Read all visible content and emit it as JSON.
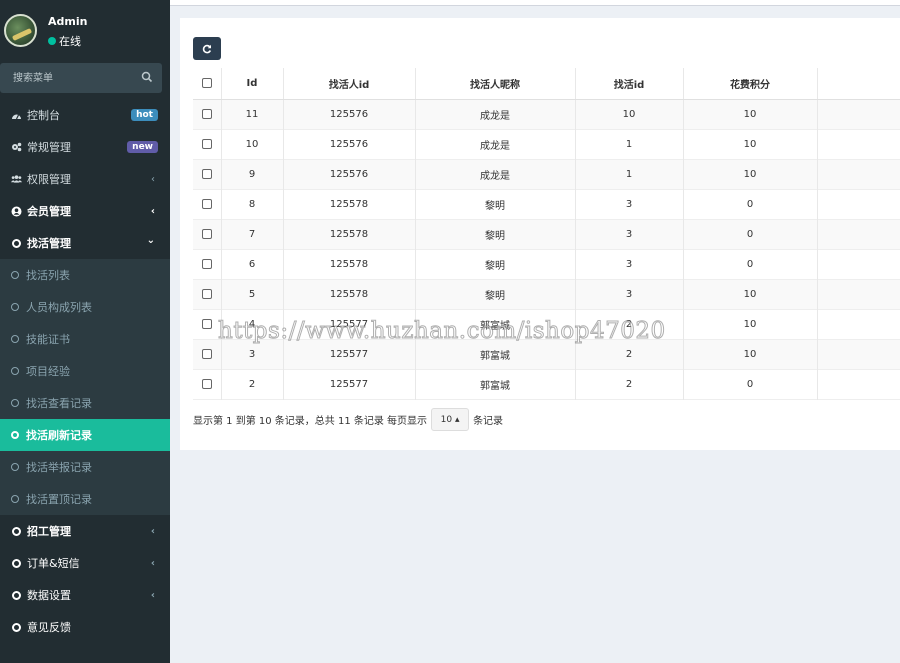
{
  "user": {
    "name": "Admin",
    "status": "在线"
  },
  "search": {
    "placeholder": "搜索菜单"
  },
  "menu": [
    {
      "label": "控制台",
      "badge": "hot"
    },
    {
      "label": "常规管理",
      "badge": "new"
    },
    {
      "label": "权限管理",
      "chevron": "‹"
    },
    {
      "label": "会员管理",
      "chevron": "‹"
    },
    {
      "label": "找活管理",
      "chevron": "⌄"
    },
    {
      "label": "招工管理",
      "chevron": "‹"
    },
    {
      "label": "订单&短信",
      "chevron": "‹"
    },
    {
      "label": "数据设置",
      "chevron": "‹"
    },
    {
      "label": "意见反馈"
    }
  ],
  "submenu": [
    {
      "label": "找活列表"
    },
    {
      "label": "人员构成列表"
    },
    {
      "label": "技能证书"
    },
    {
      "label": "项目经验"
    },
    {
      "label": "找活查看记录"
    },
    {
      "label": "找活刷新记录"
    },
    {
      "label": "找活举报记录"
    },
    {
      "label": "找活置顶记录"
    }
  ],
  "table": {
    "headers": [
      "Id",
      "找活人id",
      "找活人昵称",
      "找活id",
      "花费积分"
    ],
    "rows": [
      [
        "11",
        "125576",
        "成龙是",
        "10",
        "10"
      ],
      [
        "10",
        "125576",
        "成龙是",
        "1",
        "10"
      ],
      [
        "9",
        "125576",
        "成龙是",
        "1",
        "10"
      ],
      [
        "8",
        "125578",
        "黎明",
        "3",
        "0"
      ],
      [
        "7",
        "125578",
        "黎明",
        "3",
        "0"
      ],
      [
        "6",
        "125578",
        "黎明",
        "3",
        "0"
      ],
      [
        "5",
        "125578",
        "黎明",
        "3",
        "10"
      ],
      [
        "4",
        "125577",
        "郭富城",
        "2",
        "10"
      ],
      [
        "3",
        "125577",
        "郭富城",
        "2",
        "10"
      ],
      [
        "2",
        "125577",
        "郭富城",
        "2",
        "0"
      ]
    ]
  },
  "pagination": {
    "summary": "显示第 1 到第 10 条记录，总共 11 条记录 每页显示",
    "page_size": "10 ▴",
    "suffix": "条记录"
  },
  "watermark": "https://www.huzhan.com/ishop47020",
  "colors": {
    "sidebar": "#222d32",
    "active": "#1abc9c",
    "hot": "#3c8dbc",
    "new": "#605ca8",
    "button": "#2c3e50"
  }
}
